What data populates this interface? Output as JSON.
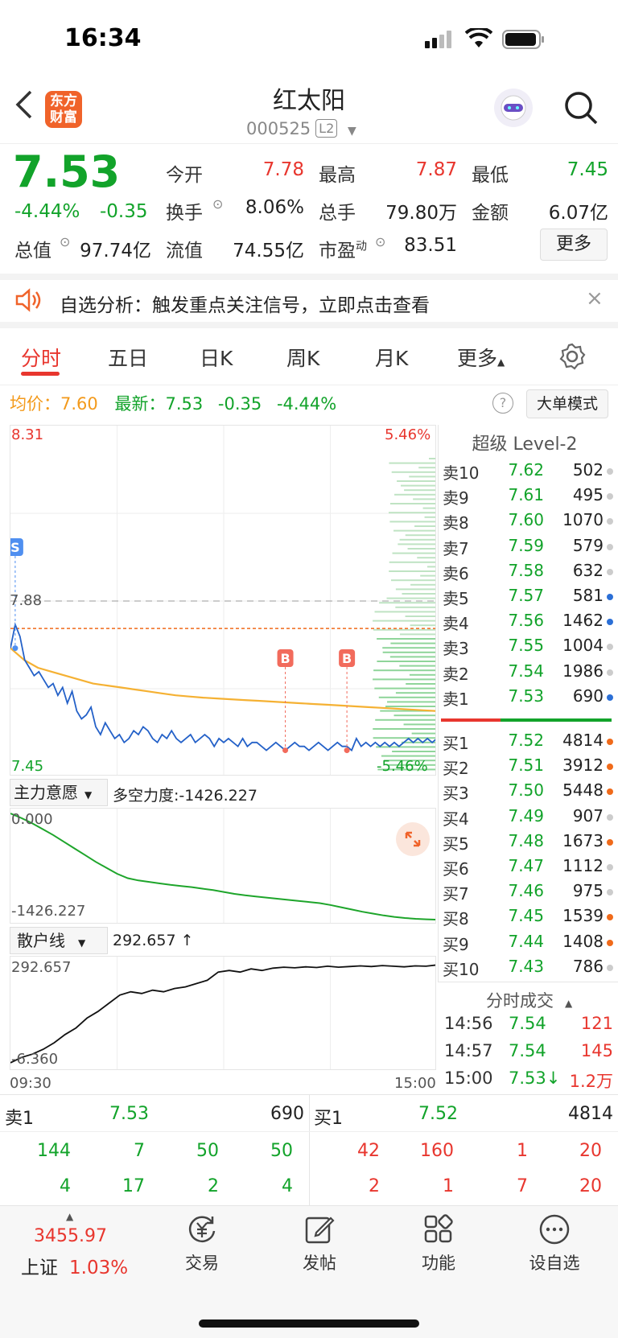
{
  "status_bar": {
    "time": "16:34"
  },
  "header": {
    "title": "红太阳",
    "code": "000525",
    "level_badge": "L2",
    "logo_line1": "东方",
    "logo_line2": "财富"
  },
  "quote": {
    "price": "7.53",
    "change_pct": "-4.44%",
    "change": "-0.35",
    "open_label": "今开",
    "open": "7.78",
    "high_label": "最高",
    "high": "7.87",
    "low_label": "最低",
    "low": "7.45",
    "turnover_label": "换手",
    "turnover": "8.06%",
    "volume_label": "总手",
    "volume": "79.80万",
    "amount_label": "金额",
    "amount": "6.07亿",
    "mktcap_label": "总值",
    "mktcap": "97.74亿",
    "float_label": "流值",
    "float_cap": "74.55亿",
    "pe_label": "市盈",
    "pe_sup": "动",
    "pe": "83.51",
    "more_label": "更多"
  },
  "notice": {
    "text": "自选分析：触发重点关注信号，立即点击查看"
  },
  "tabs": [
    "分时",
    "五日",
    "日K",
    "周K",
    "月K",
    "更多"
  ],
  "sub_header": {
    "avg_label": "均价：",
    "avg": "7.60",
    "latest_label": "最新：",
    "latest": "7.53",
    "change": "-0.35",
    "change_pct": "-4.44%",
    "mode_label": "大单模式"
  },
  "chart_data": [
    {
      "type": "line",
      "title": "",
      "x_range": [
        "09:30",
        "15:00"
      ],
      "ylim": [
        7.45,
        8.31
      ],
      "ylim_pct": [
        "5.46%",
        "-5.46%"
      ],
      "prev_close_label": "7.88",
      "prev_close": 7.88,
      "series": [
        {
          "values": [
            7.76,
            7.82,
            7.79,
            7.73,
            7.71,
            7.69,
            7.7,
            7.68,
            7.66,
            7.67,
            7.64,
            7.66,
            7.62,
            7.65,
            7.6,
            7.58,
            7.59,
            7.61,
            7.56,
            7.54,
            7.57,
            7.55,
            7.53,
            7.54,
            7.52,
            7.53,
            7.55,
            7.54,
            7.56,
            7.55,
            7.53,
            7.52,
            7.54,
            7.53,
            7.55,
            7.53,
            7.52,
            7.53,
            7.54,
            7.52,
            7.53,
            7.54,
            7.53,
            7.51,
            7.53,
            7.52,
            7.53,
            7.52,
            7.51,
            7.53,
            7.51,
            7.52,
            7.52,
            7.51,
            7.5,
            7.51,
            7.52,
            7.51,
            7.5,
            7.51,
            7.52,
            7.51,
            7.51,
            7.5,
            7.51,
            7.52,
            7.51,
            7.5,
            7.51,
            7.52,
            7.51,
            7.51,
            7.5,
            7.53,
            7.51,
            7.52,
            7.51,
            7.52,
            7.51,
            7.52,
            7.51,
            7.52,
            7.51,
            7.52,
            7.53,
            7.52,
            7.53,
            7.52,
            7.53,
            7.52,
            7.53
          ]
        },
        {
          "values": [
            7.76,
            7.73,
            7.71,
            7.7,
            7.69,
            7.68,
            7.67,
            7.665,
            7.66,
            7.655,
            7.65,
            7.645,
            7.64,
            7.637,
            7.634,
            7.632,
            7.63,
            7.628,
            7.626,
            7.624,
            7.622,
            7.62,
            7.618,
            7.616,
            7.614,
            7.612,
            7.61,
            7.608,
            7.606,
            7.604,
            7.602,
            7.6
          ]
        }
      ],
      "markers": [
        {
          "label": "S"
        },
        {
          "label": "B"
        },
        {
          "label": "B"
        }
      ]
    },
    {
      "type": "line",
      "title": "主力意愿",
      "indicator_label": "多空力度:",
      "indicator_value": "-1426.227",
      "ylim": [
        -1426.227,
        0.0
      ],
      "ytick_top": "0.000",
      "ytick_bottom": "-1426.227",
      "series": [
        {
          "values": [
            0,
            -60,
            -130,
            -210,
            -290,
            -380,
            -470,
            -560,
            -650,
            -730,
            -810,
            -870,
            -900,
            -920,
            -940,
            -960,
            -975,
            -990,
            -1010,
            -1030,
            -1055,
            -1080,
            -1100,
            -1115,
            -1130,
            -1145,
            -1160,
            -1175,
            -1190,
            -1205,
            -1230,
            -1260,
            -1290,
            -1320,
            -1345,
            -1370,
            -1390,
            -1405,
            -1415,
            -1422,
            -1426
          ]
        }
      ]
    },
    {
      "type": "line",
      "title": "散户线",
      "indicator_value": "292.657 ↑",
      "ylim": [
        -6.36,
        292.657
      ],
      "ytick_top": "292.657",
      "ytick_bottom": "-6.360",
      "x_start": "09:30",
      "x_end": "15:00",
      "series": [
        {
          "values": [
            -6,
            10,
            20,
            35,
            55,
            80,
            100,
            130,
            150,
            175,
            200,
            210,
            205,
            215,
            210,
            220,
            225,
            235,
            245,
            270,
            275,
            270,
            280,
            275,
            282,
            285,
            283,
            286,
            284,
            288,
            285,
            287,
            289,
            287,
            290,
            288,
            286,
            289,
            288,
            292
          ]
        }
      ]
    }
  ],
  "orderbook": {
    "title": "超级 Level-2",
    "asks": [
      {
        "label": "卖10",
        "price": "7.62",
        "vol": "502",
        "dot": "#cccccc"
      },
      {
        "label": "卖9",
        "price": "7.61",
        "vol": "495",
        "dot": "#cccccc"
      },
      {
        "label": "卖8",
        "price": "7.60",
        "vol": "1070",
        "dot": "#cccccc"
      },
      {
        "label": "卖7",
        "price": "7.59",
        "vol": "579",
        "dot": "#cccccc"
      },
      {
        "label": "卖6",
        "price": "7.58",
        "vol": "632",
        "dot": "#cccccc"
      },
      {
        "label": "卖5",
        "price": "7.57",
        "vol": "581",
        "dot": "#2b6fd6"
      },
      {
        "label": "卖4",
        "price": "7.56",
        "vol": "1462",
        "dot": "#2b6fd6"
      },
      {
        "label": "卖3",
        "price": "7.55",
        "vol": "1004",
        "dot": "#cccccc"
      },
      {
        "label": "卖2",
        "price": "7.54",
        "vol": "1986",
        "dot": "#cccccc"
      },
      {
        "label": "卖1",
        "price": "7.53",
        "vol": "690",
        "dot": "#2b6fd6"
      }
    ],
    "bids": [
      {
        "label": "买1",
        "price": "7.52",
        "vol": "4814",
        "dot": "#f06a1a"
      },
      {
        "label": "买2",
        "price": "7.51",
        "vol": "3912",
        "dot": "#f06a1a"
      },
      {
        "label": "买3",
        "price": "7.50",
        "vol": "5448",
        "dot": "#f06a1a"
      },
      {
        "label": "买4",
        "price": "7.49",
        "vol": "907",
        "dot": "#cccccc"
      },
      {
        "label": "买5",
        "price": "7.48",
        "vol": "1673",
        "dot": "#f06a1a"
      },
      {
        "label": "买6",
        "price": "7.47",
        "vol": "1112",
        "dot": "#cccccc"
      },
      {
        "label": "买7",
        "price": "7.46",
        "vol": "975",
        "dot": "#cccccc"
      },
      {
        "label": "买8",
        "price": "7.45",
        "vol": "1539",
        "dot": "#f06a1a"
      },
      {
        "label": "买9",
        "price": "7.44",
        "vol": "1408",
        "dot": "#f06a1a"
      },
      {
        "label": "买10",
        "price": "7.43",
        "vol": "786",
        "dot": "#cccccc"
      }
    ]
  },
  "trades": {
    "title": "分时成交",
    "rows": [
      {
        "time": "14:56",
        "price": "7.54",
        "vol": "121"
      },
      {
        "time": "14:57",
        "price": "7.54",
        "vol": "145"
      },
      {
        "time": "15:00",
        "price": "7.53↓",
        "vol": "1.2万"
      }
    ]
  },
  "bottom_book": {
    "sell_label": "卖1",
    "sell_price": "7.53",
    "sell_vol": "690",
    "buy_label": "买1",
    "buy_price": "7.52",
    "buy_vol": "4814",
    "sell_row1": [
      "144",
      "7",
      "50",
      "50"
    ],
    "sell_row2": [
      "4",
      "17",
      "2",
      "4"
    ],
    "buy_row1": [
      "42",
      "160",
      "1",
      "20"
    ],
    "buy_row2": [
      "2",
      "1",
      "7",
      "20"
    ]
  },
  "bottom_nav": {
    "index_value": "3455.97",
    "index_name": "上证",
    "index_change": "1.03%",
    "items": [
      "交易",
      "发帖",
      "功能",
      "设自选"
    ]
  },
  "colors": {
    "up": "#e8362e",
    "down": "#12a32a",
    "avg": "#f5b133",
    "accent": "#f0632a"
  }
}
